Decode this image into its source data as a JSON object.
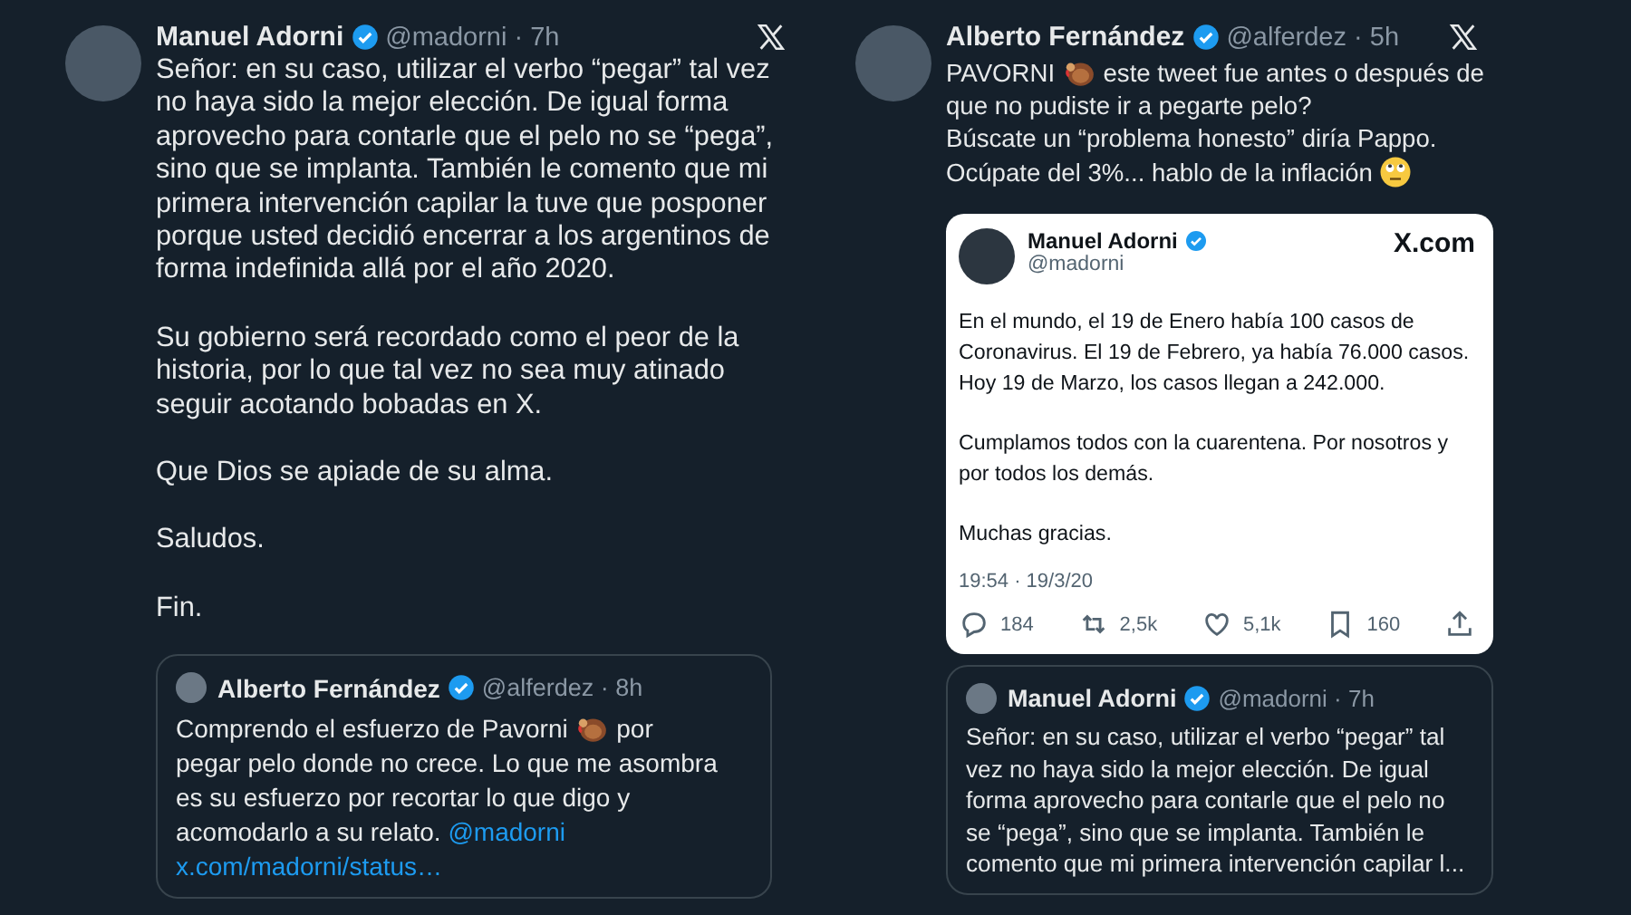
{
  "tweets": [
    {
      "author": {
        "name": "Manuel Adorni",
        "verified": true,
        "handle": "@madorni · 7h"
      },
      "paragraphs": [
        [
          {
            "kind": "text",
            "text": "Señor: en su caso, utilizar el verbo “pegar” tal vez no haya sido la mejor elección. De igual forma aprovecho para contarle que el pelo no se “pega”, sino que se implanta. También le comento que mi primera intervención capilar la tuve que posponer porque usted decidió encerrar a los argentinos de forma indefinida allá por el año 2020."
          }
        ],
        [
          {
            "kind": "text",
            "text": "Su gobierno será recordado como el peor de la historia, por lo que tal vez no sea muy atinado seguir acotando bobadas en X."
          }
        ],
        [
          {
            "kind": "text",
            "text": "Que Dios se apiade de su alma."
          }
        ],
        [
          {
            "kind": "text",
            "text": "Saludos."
          }
        ],
        [
          {
            "kind": "text",
            "text": "Fin."
          }
        ]
      ],
      "cards": [
        {
          "kind": "quote",
          "author": {
            "name": "Alberto Fernández",
            "verified": true,
            "handle": "@alferdez · 8h"
          },
          "paragraphs": [
            [
              {
                "kind": "text",
                "text": "Comprendo el esfuerzo de Pavorni"
              },
              {
                "kind": "turkey"
              },
              {
                "kind": "text",
                "text": "por"
              },
              {
                "kind": "break"
              },
              {
                "kind": "text",
                "text": "pegar pelo donde no crece. Lo que me asombra"
              },
              {
                "kind": "break"
              },
              {
                "kind": "text",
                "text": "es su esfuerzo por recortar lo que digo y"
              },
              {
                "kind": "break"
              },
              {
                "kind": "text",
                "text": "acomodarlo a su relato."
              },
              {
                "kind": "link",
                "text": "@madorni"
              },
              {
                "kind": "link",
                "text": "x.com/madorni/status…"
              }
            ]
          ]
        }
      ]
    },
    {
      "author": {
        "name": "Alberto Fernández",
        "verified": true,
        "handle": "@alferdez · 5h"
      },
      "paragraphs": [
        [
          {
            "kind": "text",
            "text": "PAVORNI"
          },
          {
            "kind": "turkey"
          },
          {
            "kind": "text",
            "text": "este tweet fue antes o después de"
          },
          {
            "kind": "break"
          },
          {
            "kind": "text",
            "text": "que no pudiste ir a pegarte pelo?"
          },
          {
            "kind": "break"
          },
          {
            "kind": "text",
            "text": "Búscate un “problema honesto” diría Pappo."
          },
          {
            "kind": "break"
          },
          {
            "kind": "text",
            "text": "Ocúpate del 3%... hablo de la inflación"
          },
          {
            "kind": "eyeroll"
          }
        ]
      ],
      "cards": [
        {
          "kind": "screenshot",
          "author": {
            "name": "Manuel Adorni",
            "verified": true,
            "handle": "@madorni"
          },
          "brand": "X.com",
          "paragraphs": [
            [
              {
                "kind": "text",
                "text": "En el mundo, el 19 de Enero había 100 casos de Coronavirus. El 19 de Febrero, ya había 76.000 casos. Hoy 19 de Marzo, los casos llegan a 242.000."
              }
            ],
            [
              {
                "kind": "text",
                "text": "Cumplamos todos con la cuarentena. Por nosotros y por todos los demás."
              }
            ],
            [
              {
                "kind": "text",
                "text": "Muchas gracias."
              }
            ]
          ],
          "timestamp": "19:54 · 19/3/20",
          "stats": [
            {
              "kind": "reply",
              "count": "184"
            },
            {
              "kind": "repost",
              "count": "2,5k"
            },
            {
              "kind": "like",
              "count": "5,1k"
            },
            {
              "kind": "bookmark",
              "count": "160"
            },
            {
              "kind": "share"
            }
          ]
        },
        {
          "kind": "quote",
          "author": {
            "name": "Manuel Adorni",
            "verified": true,
            "handle": "@madorni · 7h"
          },
          "paragraphs": [
            [
              {
                "kind": "text",
                "text": "Señor: en su caso, utilizar el verbo “pegar” tal vez no haya sido la mejor elección. De igual forma aprovecho para contarle que el pelo no se “pega”, sino que se implanta. También le comento que mi primera intervención capilar l..."
              }
            ]
          ]
        }
      ]
    }
  ]
}
